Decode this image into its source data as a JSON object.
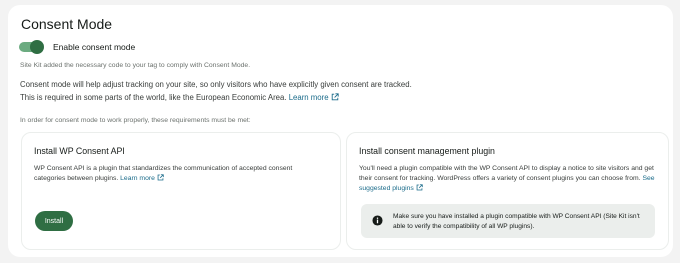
{
  "section": {
    "title": "Consent Mode",
    "toggle_label": "Enable consent mode",
    "toggle_on": true,
    "small_note": "Site Kit added the necessary code to your tag to comply with Consent Mode.",
    "description_line1": "Consent mode will help adjust tracking on your site, so only visitors who have explicitly given consent are tracked.",
    "description_line2": "This is required in some parts of the world, like the European Economic Area.",
    "learn_more": "Learn more",
    "requirements_note": "In order for consent mode to work properly, these requirements must be met:"
  },
  "card_api": {
    "title": "Install WP Consent API",
    "text": "WP Consent API is a plugin that standardizes the communication of accepted consent categories between plugins.",
    "learn_more": "Learn more",
    "install_label": "Install"
  },
  "card_plugin": {
    "title": "Install consent management plugin",
    "text": "You'll need a plugin compatible with the WP Consent API to display a notice to site visitors and get their consent for tracking. WordPress offers a variety of consent plugins you can choose from.",
    "suggested_link": "See suggested plugins",
    "notice_text": "Make sure you have installed a plugin compatible with WP Consent API (Site Kit isn't able to verify the compatibility of all WP plugins)."
  },
  "colors": {
    "accent": "#2f6e43",
    "toggle_track": "#6bab80",
    "link": "#1a6b8a",
    "notice_bg": "#ebeeec"
  },
  "icons": [
    "external-link-icon",
    "info-icon"
  ]
}
